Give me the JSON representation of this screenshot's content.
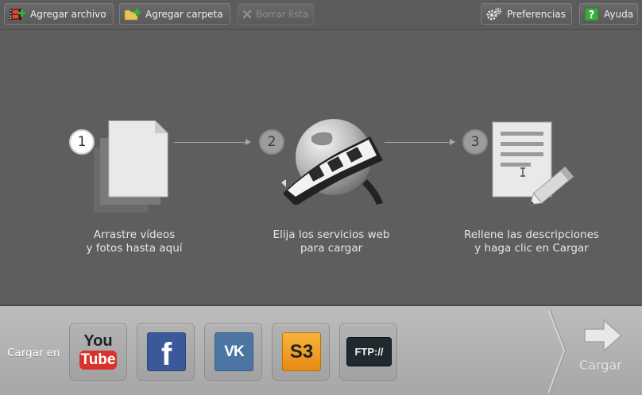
{
  "toolbar": {
    "add_file": "Agregar archivo",
    "add_folder": "Agregar carpeta",
    "clear_list": "Borrar lista",
    "preferences": "Preferencias",
    "help": "Ayuda"
  },
  "steps": [
    {
      "number": "1",
      "line1": "Arrastre vídeos",
      "line2": "y fotos hasta aquí"
    },
    {
      "number": "2",
      "line1": "Elija los servicios web",
      "line2": "para cargar"
    },
    {
      "number": "3",
      "line1": "Rellene las descripciones",
      "line2": "y haga clic en Cargar"
    }
  ],
  "bottom": {
    "upload_to_label": "Cargar en",
    "services": [
      {
        "name": "YouTube",
        "top_text": "You",
        "bottom_text": "Tube"
      },
      {
        "name": "Facebook",
        "text": "f"
      },
      {
        "name": "VK",
        "text": "VK"
      },
      {
        "name": "Amazon S3",
        "text": "S3"
      },
      {
        "name": "FTP",
        "text": "FTP://"
      }
    ],
    "upload_button": "Cargar"
  },
  "colors": {
    "background": "#5e5e5e",
    "bottom_bar": "#b3b3b3",
    "add_icon_green": "#2fb52f",
    "youtube_red": "#d9322b",
    "facebook_blue": "#3b5998",
    "vk_blue": "#4c75a3",
    "s3_orange": "#f39a1f",
    "ftp_dark": "#1f2a2e"
  },
  "icons": [
    "film-add-icon",
    "folder-add-icon",
    "close-icon",
    "gears-icon",
    "help-icon",
    "document-stack-icon",
    "globe-film-icon",
    "form-pencil-icon",
    "arrow-right-icon"
  ]
}
